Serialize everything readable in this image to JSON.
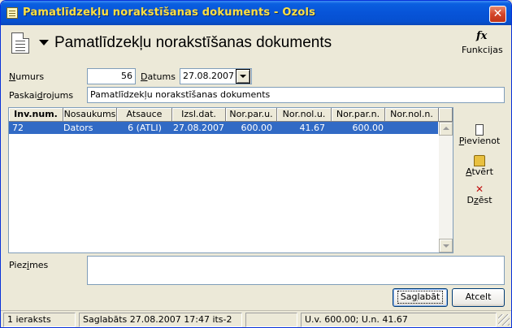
{
  "window": {
    "title": "Pamatlīdzekļu norakstīšanas dokuments - Ozols",
    "close_glyph": "✕"
  },
  "header": {
    "title": "Pamatlīdzekļu norakstīšanas dokuments",
    "functions_label": "Funkcijas",
    "functions_glyph": "fx"
  },
  "form": {
    "number_label_pre": "",
    "number_label_u": "N",
    "number_label_post": "umurs",
    "number_value": "56",
    "date_label_pre": "",
    "date_label_u": "D",
    "date_label_post": "atums",
    "date_value": "27.08.2007",
    "desc_label_pre": "Paskai",
    "desc_label_u": "d",
    "desc_label_post": "rojums",
    "desc_value": "Pamatlīdzekļu norakstīšanas dokuments",
    "notes_label_pre": "Piez",
    "notes_label_u": "i",
    "notes_label_post": "mes",
    "notes_value": ""
  },
  "grid": {
    "columns": [
      "Inv.num.",
      "Nosaukums",
      "Atsauce",
      "Izsl.dat.",
      "Nor.par.u.",
      "Nor.nol.u.",
      "Nor.par.n.",
      "Nor.nol.n."
    ],
    "rows": [
      {
        "inv": "72",
        "name": "Dators",
        "ref": "6 (ATLI)",
        "date": "27.08.2007",
        "npu": "600.00",
        "nnu": "41.67",
        "npn": "600.00",
        "nnn": ""
      }
    ]
  },
  "side_buttons": {
    "add_pre": "",
    "add_u": "P",
    "add_post": "ievienot",
    "open_pre": "",
    "open_u": "A",
    "open_post": "tvērt",
    "delete_pre": "D",
    "delete_u": "z",
    "delete_post": "ēst",
    "delete_glyph": "✕"
  },
  "buttons": {
    "save_pre": "Sa",
    "save_u": "g",
    "save_post": "labāt",
    "cancel": "Atcelt"
  },
  "status": {
    "count": "1 ieraksts",
    "saved": "Saglabāts 27.08.2007 17:47 its-2",
    "empty": "",
    "totals": "U.v. 600.00; U.n. 41.67"
  },
  "colors": {
    "selection": "#316ac5",
    "title_text": "#ffe040",
    "titlebar": "#0754d8"
  }
}
